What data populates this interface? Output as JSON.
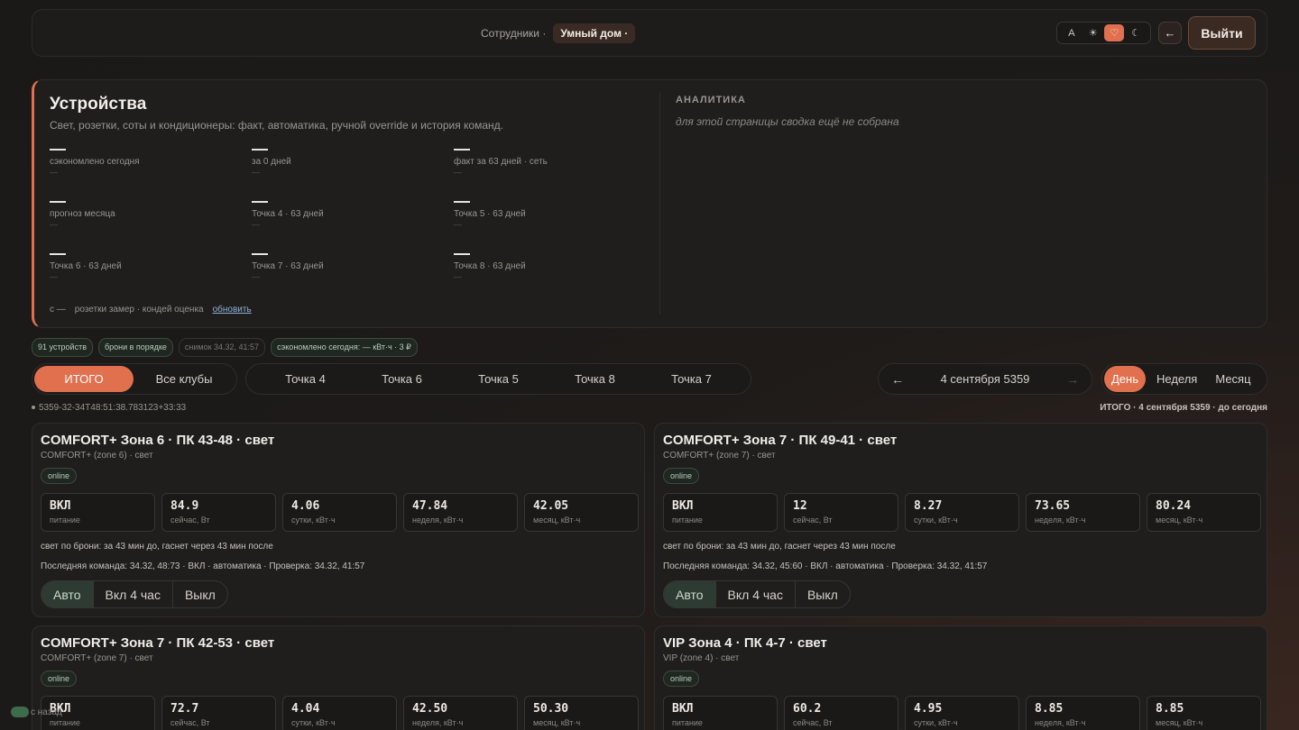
{
  "nav": {
    "crumbs": [
      "Сотрудники",
      "Умный дом"
    ],
    "active_index": 1,
    "theme_options": [
      "A",
      "☀",
      "♡",
      "☾"
    ],
    "theme_active": 2,
    "back_glyph": "←",
    "logout_label": "Выйти"
  },
  "devices": {
    "title": "Устройства",
    "subtitle": "Свет, розетки, соты и кондиционеры: факт, автоматика, ручной override и история команд.",
    "stats": [
      {
        "value": "—",
        "label": "сэкономлено сегодня",
        "sub": "—"
      },
      {
        "value": "—",
        "label": "за 0 дней",
        "sub": "—"
      },
      {
        "value": "—",
        "label": "факт за 63 дней · сеть",
        "sub": "—"
      },
      {
        "value": "—",
        "label": "прогноз месяца",
        "sub": "—"
      },
      {
        "value": "—",
        "label": "Точка 4 · 63 дней",
        "sub": "—"
      },
      {
        "value": "—",
        "label": "Точка 5 · 63 дней",
        "sub": "—"
      },
      {
        "value": "—",
        "label": "Точка 6 · 63 дней",
        "sub": "—"
      },
      {
        "value": "—",
        "label": "Точка 7 · 63 дней",
        "sub": "—"
      },
      {
        "value": "—",
        "label": "Точка 8 · 63 дней",
        "sub": "—"
      }
    ],
    "status_prefix": "с —",
    "status_text": "розетки замер · кондей оценка",
    "refresh_label": "обновить",
    "analytics_title": "АНАЛИТИКА",
    "analytics_text": "для этой страницы сводка ещё не собрана"
  },
  "chips": [
    "91 устройств",
    "брони в порядке",
    "снимок 34.32, 41:57",
    "сэкономлено сегодня: — кВт·ч · 3 ₽"
  ],
  "filters": {
    "groups": [
      "ИТОГО",
      "Все клубы"
    ],
    "points": [
      "Точка 4",
      "Точка 6",
      "Точка 5",
      "Точка 8",
      "Точка 7"
    ],
    "date": "4 сентября 5359",
    "prev": "←",
    "next": "→",
    "periods": [
      "День",
      "Неделя",
      "Месяц"
    ]
  },
  "timestamp_left": "5359-32-34T48:51:38.783123+33:33",
  "timestamp_right": "ИТОГО · 4 сентября 5359 · до сегодня",
  "cards": [
    {
      "title": "COMFORT+ Зона 6 · ПК 43-48 · свет",
      "sub": "COMFORT+ (zone 6) · свет",
      "badge": "online",
      "metrics": [
        {
          "v": "ВКЛ",
          "l": "питание"
        },
        {
          "v": "84.9",
          "l": "сейчас, Вт"
        },
        {
          "v": "4.06",
          "l": "сутки, кВт·ч"
        },
        {
          "v": "47.84",
          "l": "неделя, кВт·ч"
        },
        {
          "v": "42.05",
          "l": "месяц, кВт·ч"
        }
      ],
      "note": "свет по брони: за 43 мин до, гаснет через 43 мин после",
      "cmd": "Последняя команда: 34.32, 48:73 · ВКЛ · автоматика · Проверка: 34.32, 41:57",
      "modes": [
        "Авто",
        "Вкл 4 час",
        "Выкл"
      ]
    },
    {
      "title": "COMFORT+ Зона 7 · ПК 49-41 · свет",
      "sub": "COMFORT+ (zone 7) · свет",
      "badge": "online",
      "metrics": [
        {
          "v": "ВКЛ",
          "l": "питание"
        },
        {
          "v": "12",
          "l": "сейчас, Вт"
        },
        {
          "v": "8.27",
          "l": "сутки, кВт·ч"
        },
        {
          "v": "73.65",
          "l": "неделя, кВт·ч"
        },
        {
          "v": "80.24",
          "l": "месяц, кВт·ч"
        }
      ],
      "note": "свет по брони: за 43 мин до, гаснет через 43 мин после",
      "cmd": "Последняя команда: 34.32, 45:60 · ВКЛ · автоматика · Проверка: 34.32, 41:57",
      "modes": [
        "Авто",
        "Вкл 4 час",
        "Выкл"
      ]
    },
    {
      "title": "COMFORT+ Зона 7 · ПК 42-53 · свет",
      "sub": "COMFORT+ (zone 7) · свет",
      "badge": "online",
      "metrics": [
        {
          "v": "ВКЛ",
          "l": "питание"
        },
        {
          "v": "72.7",
          "l": "сейчас, Вт"
        },
        {
          "v": "4.04",
          "l": "сутки, кВт·ч"
        },
        {
          "v": "42.50",
          "l": "неделя, кВт·ч"
        },
        {
          "v": "50.30",
          "l": "месяц, кВт·ч"
        }
      ]
    },
    {
      "title": "VIP Зона 4 · ПК 4-7 · свет",
      "sub": "VIP (zone 4) · свет",
      "badge": "online",
      "metrics": [
        {
          "v": "ВКЛ",
          "l": "питание"
        },
        {
          "v": "60.2",
          "l": "сейчас, Вт"
        },
        {
          "v": "4.95",
          "l": "сутки, кВт·ч"
        },
        {
          "v": "8.85",
          "l": "неделя, кВт·ч"
        },
        {
          "v": "8.85",
          "l": "месяц, кВт·ч"
        }
      ]
    }
  ],
  "toast": "с назад"
}
